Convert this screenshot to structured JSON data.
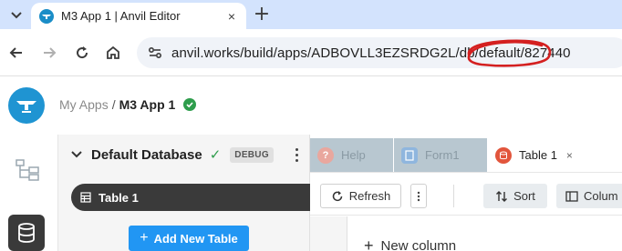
{
  "browser": {
    "tab": {
      "title": "M3 App 1 | Anvil Editor",
      "favicon": "anvil-logo-icon"
    },
    "new_tab_symbol": "+",
    "close_symbol": "×",
    "url": "anvil.works/build/apps/ADBOVLL3EZSRDG2L/db/default/827440"
  },
  "app": {
    "breadcrumb": {
      "parent": "My Apps",
      "separator": "/",
      "current": "M3 App 1"
    },
    "status_colors": {
      "ok": "#2e9d4c"
    }
  },
  "database_panel": {
    "title": "Default Database",
    "check": "✓",
    "badge": "DEBUG",
    "tables": [
      {
        "label": "Table 1"
      }
    ],
    "add_table_label": "Add New Table",
    "add_symbol": "+"
  },
  "editor_tabs": [
    {
      "label": "Help",
      "icon": "help-icon",
      "icon_glyph": "?",
      "color": "#e07b6e",
      "active": false
    },
    {
      "label": "Form1",
      "icon": "form-icon",
      "icon_glyph": "",
      "color": "#5b9ad8",
      "active": false
    },
    {
      "label": "Table 1",
      "icon": "table-icon",
      "icon_glyph": "",
      "color": "#e2553c",
      "active": true
    }
  ],
  "table_toolbar": {
    "refresh_label": "Refresh",
    "sort_label": "Sort",
    "columns_label": "Colum"
  },
  "grid": {
    "new_column_label": "New column",
    "add_symbol": "+"
  },
  "colors": {
    "accent": "#2196f3",
    "brand": "#1f94d2",
    "annotation": "#d42020"
  }
}
